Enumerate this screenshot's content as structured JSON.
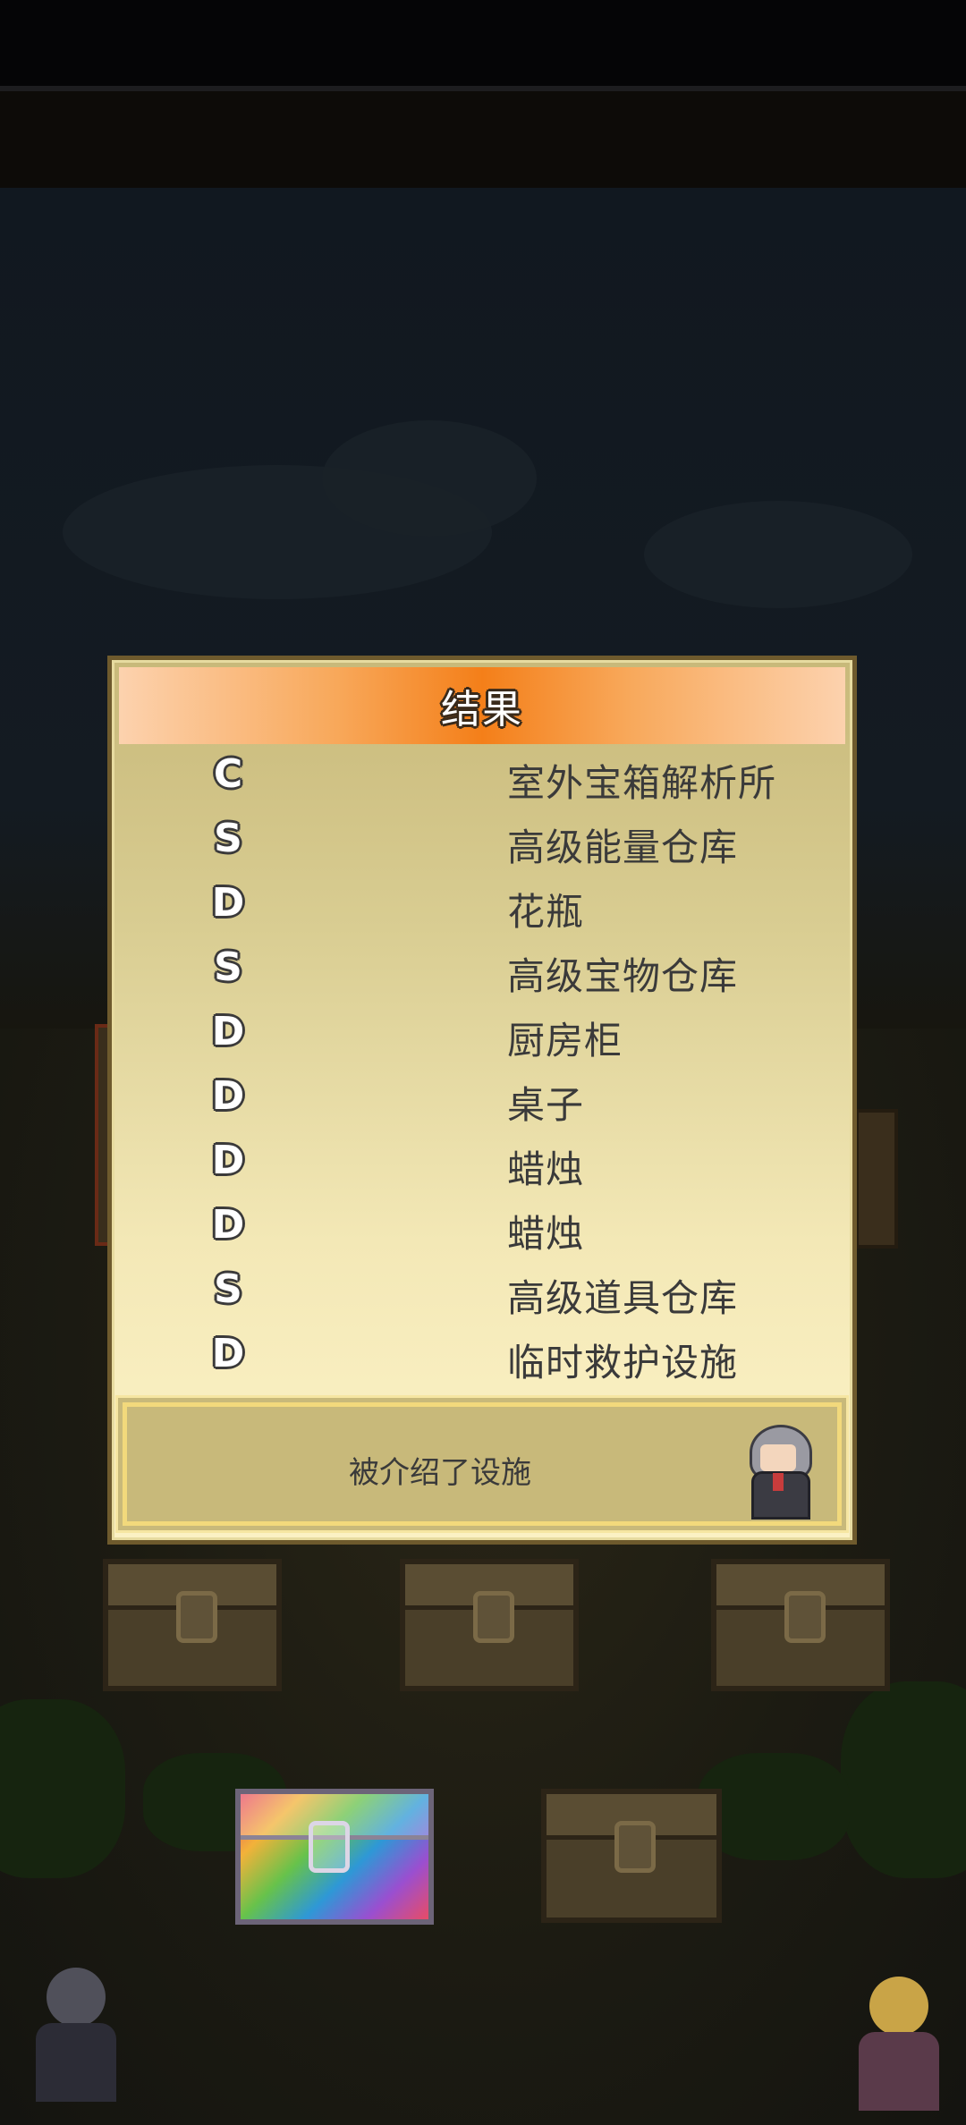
{
  "dialog": {
    "title": "结果",
    "results": [
      {
        "grade": "C",
        "facility": "室外宝箱解析所"
      },
      {
        "grade": "S",
        "facility": "高级能量仓库"
      },
      {
        "grade": "D",
        "facility": "花瓶"
      },
      {
        "grade": "S",
        "facility": "高级宝物仓库"
      },
      {
        "grade": "D",
        "facility": "厨房柜"
      },
      {
        "grade": "D",
        "facility": "桌子"
      },
      {
        "grade": "D",
        "facility": "蜡烛"
      },
      {
        "grade": "D",
        "facility": "蜡烛"
      },
      {
        "grade": "S",
        "facility": "高级道具仓库"
      },
      {
        "grade": "D",
        "facility": "临时救护设施"
      }
    ],
    "message": "被介绍了设施",
    "advisor_icon": "gray-haired-advisor-portrait"
  },
  "colors": {
    "header_orange": "#f47f19",
    "dialog_cream": "#fbf1c4",
    "dialog_khaki": "#c8b97a",
    "text_dark": "#3a3a3a"
  }
}
